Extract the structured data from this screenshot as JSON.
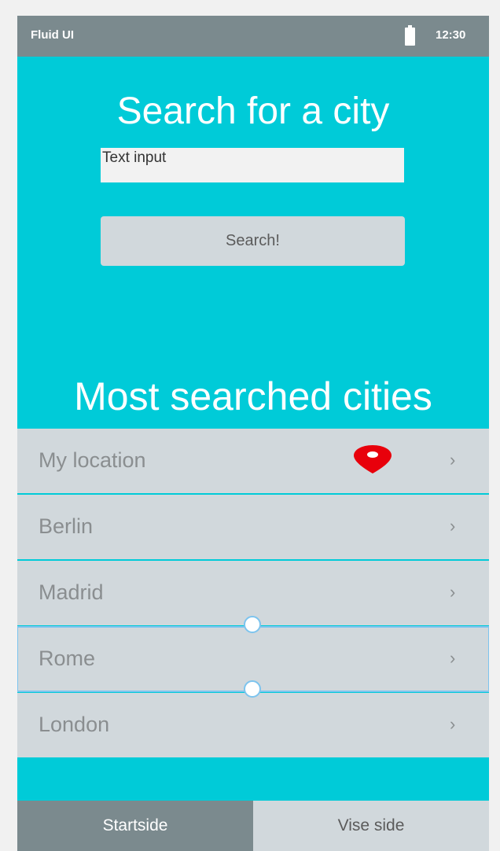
{
  "status_bar": {
    "app_name": "Fluid UI",
    "time": "12:30"
  },
  "search": {
    "heading": "Search for a city",
    "input_placeholder": "Text input",
    "button_label": "Search!"
  },
  "most_searched": {
    "heading": "Most searched cities",
    "cities": [
      {
        "label": "My location",
        "icon": "location-pin-icon"
      },
      {
        "label": "Berlin"
      },
      {
        "label": "Madrid"
      },
      {
        "label": "Rome",
        "selected": true
      },
      {
        "label": "London"
      }
    ],
    "chevron": "›"
  },
  "tabs": [
    {
      "label": "Startside",
      "active": true
    },
    {
      "label": "Vise side",
      "active": false
    }
  ],
  "colors": {
    "background": "#00cbd8",
    "status_bar": "#7b8a8e",
    "row": "#d1d8dc",
    "pin": "#e8000b",
    "selection": "#7dc4ee"
  }
}
